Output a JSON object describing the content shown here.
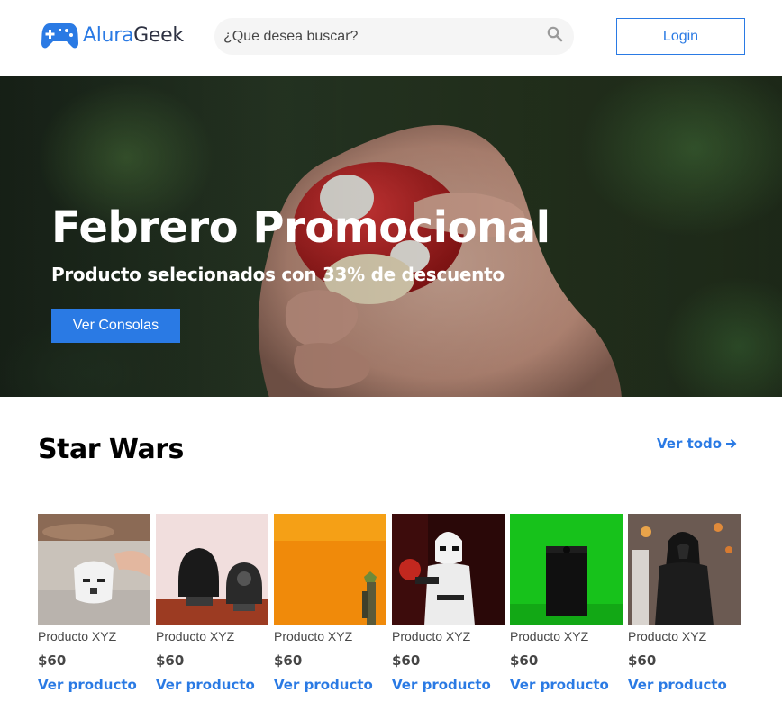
{
  "header": {
    "logo_prefix": "Alura",
    "logo_suffix": "Geek",
    "search_placeholder": "¿Que desea buscar?",
    "login_label": "Login"
  },
  "hero": {
    "title": "Febrero Promocional",
    "subtitle": "Producto selecionados con 33% de descuento",
    "button_label": "Ver Consolas"
  },
  "section": {
    "title": "Star Wars",
    "see_all_label": "Ver todo"
  },
  "products": [
    {
      "name": "Producto XYZ",
      "price": "$60",
      "link": "Ver producto"
    },
    {
      "name": "Producto XYZ",
      "price": "$60",
      "link": "Ver producto"
    },
    {
      "name": "Producto XYZ",
      "price": "$60",
      "link": "Ver producto"
    },
    {
      "name": "Producto XYZ",
      "price": "$60",
      "link": "Ver producto"
    },
    {
      "name": "Producto XYZ",
      "price": "$60",
      "link": "Ver producto"
    },
    {
      "name": "Producto XYZ",
      "price": "$60",
      "link": "Ver producto"
    }
  ],
  "colors": {
    "accent": "#2A7AE4",
    "text_secondary": "#464646",
    "search_bg": "#F5F5F5"
  }
}
